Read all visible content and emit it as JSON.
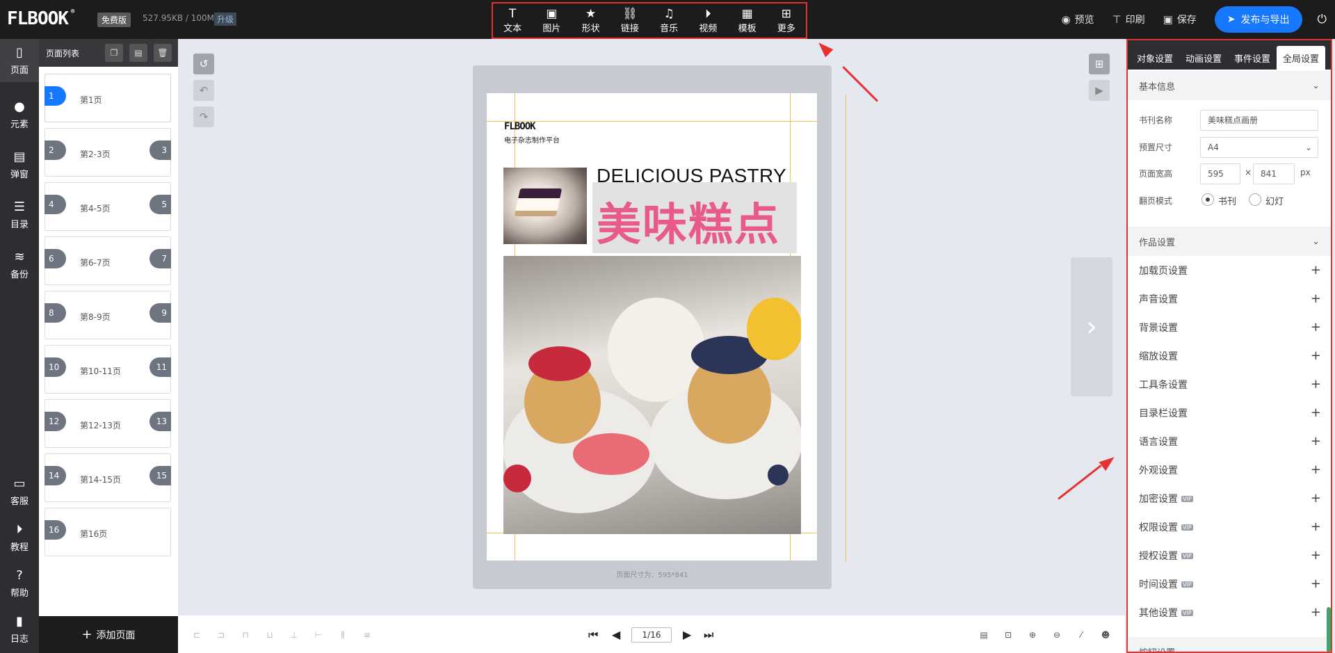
{
  "topbar": {
    "logo": "FLBOOK",
    "logo_mark": "®",
    "version_badge": "免费版",
    "storage": "527.95KB / 100M",
    "upgrade": "升级",
    "tools": [
      {
        "label": "文本",
        "icon": "text-icon",
        "glyph": "T"
      },
      {
        "label": "图片",
        "icon": "image-icon",
        "glyph": "▣"
      },
      {
        "label": "形状",
        "icon": "star-icon",
        "glyph": "★"
      },
      {
        "label": "链接",
        "icon": "link-icon",
        "glyph": "⛓"
      },
      {
        "label": "音乐",
        "icon": "music-icon",
        "glyph": "♫"
      },
      {
        "label": "视频",
        "icon": "video-icon",
        "glyph": "⏵"
      },
      {
        "label": "模板",
        "icon": "template-icon",
        "glyph": "▦"
      },
      {
        "label": "更多",
        "icon": "more-icon",
        "glyph": "⊞"
      }
    ],
    "preview": "预览",
    "print": "印刷",
    "save": "保存",
    "publish": "发布与导出"
  },
  "leftnav": {
    "items": [
      {
        "label": "页面",
        "icon": "page-icon",
        "glyph": "▯"
      },
      {
        "label": "元素",
        "icon": "elements-icon",
        "glyph": "●"
      },
      {
        "label": "弹窗",
        "icon": "popup-icon",
        "glyph": "▤"
      },
      {
        "label": "目录",
        "icon": "toc-icon",
        "glyph": "☰"
      },
      {
        "label": "备份",
        "icon": "backup-icon",
        "glyph": "≋"
      },
      {
        "label": "客服",
        "icon": "support-icon",
        "glyph": "▭"
      },
      {
        "label": "教程",
        "icon": "tutorial-icon",
        "glyph": "⏵"
      },
      {
        "label": "帮助",
        "icon": "help-icon",
        "glyph": "?"
      },
      {
        "label": "日志",
        "icon": "log-icon",
        "glyph": "▮"
      }
    ]
  },
  "pagelist": {
    "title": "页面列表",
    "pages": [
      {
        "left": "1",
        "right": "",
        "label": "第1页"
      },
      {
        "left": "2",
        "right": "3",
        "label": "第2-3页"
      },
      {
        "left": "4",
        "right": "5",
        "label": "第4-5页"
      },
      {
        "left": "6",
        "right": "7",
        "label": "第6-7页"
      },
      {
        "left": "8",
        "right": "9",
        "label": "第8-9页"
      },
      {
        "left": "10",
        "right": "11",
        "label": "第10-11页"
      },
      {
        "left": "12",
        "right": "13",
        "label": "第12-13页"
      },
      {
        "left": "14",
        "right": "15",
        "label": "第14-15页"
      },
      {
        "left": "16",
        "right": "",
        "label": "第16页"
      }
    ],
    "add_page": "添加页面"
  },
  "canvas": {
    "brand": "FLBOOK",
    "brand_sub": "电子杂志制作平台",
    "title_en": "DELICIOUS PASTRY",
    "title_cn": "美味糕点",
    "page_size": "页面尺寸为：595*841"
  },
  "bottombar": {
    "page_indicator": "1/16"
  },
  "rightpanel": {
    "tabs": [
      "对象设置",
      "动画设置",
      "事件设置",
      "全局设置"
    ],
    "basic_info": "基本信息",
    "fields": {
      "book_name_label": "书刊名称",
      "book_name": "美味糕点画册",
      "preset_label": "预置尺寸",
      "preset": "A4",
      "size_label": "页面宽高",
      "width": "595",
      "times": "×",
      "height": "841",
      "unit": "px",
      "mode_label": "翻页模式",
      "mode_book": "书刊",
      "mode_slide": "幻灯"
    },
    "work_settings": "作品设置",
    "settings": [
      {
        "label": "加载页设置",
        "vip": ""
      },
      {
        "label": "声音设置",
        "vip": ""
      },
      {
        "label": "背景设置",
        "vip": ""
      },
      {
        "label": "缩放设置",
        "vip": ""
      },
      {
        "label": "工具条设置",
        "vip": ""
      },
      {
        "label": "目录栏设置",
        "vip": ""
      },
      {
        "label": "语言设置",
        "vip": ""
      },
      {
        "label": "外观设置",
        "vip": ""
      },
      {
        "label": "加密设置",
        "vip": "VIP"
      },
      {
        "label": "权限设置",
        "vip": "VIP"
      },
      {
        "label": "授权设置",
        "vip": "VIP"
      },
      {
        "label": "时间设置",
        "vip": "VIP"
      },
      {
        "label": "其他设置",
        "vip": "VIP"
      }
    ],
    "button_settings": "按钮设置"
  },
  "colors": {
    "accent": "#1677ff",
    "highlight_border": "#e63131",
    "title_pink": "#e85a88",
    "dark_bar": "#1c1c1d"
  }
}
